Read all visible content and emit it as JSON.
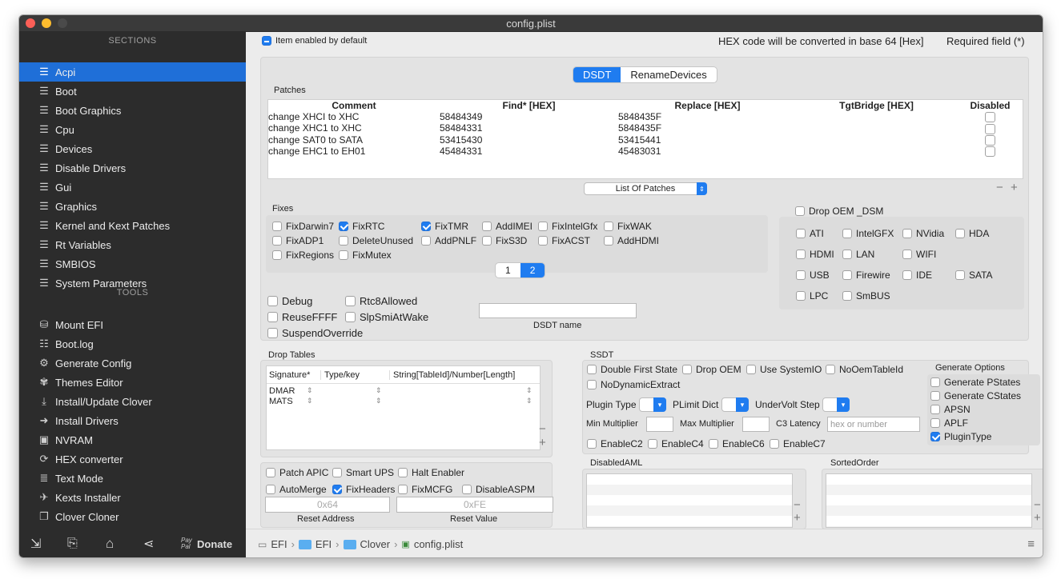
{
  "window": {
    "title": "config.plist"
  },
  "sidebar": {
    "sections_header": "SECTIONS",
    "sections": [
      {
        "label": "Acpi",
        "icon": "list-icon",
        "selected": true
      },
      {
        "label": "Boot",
        "icon": "list-icon"
      },
      {
        "label": "Boot Graphics",
        "icon": "list-icon"
      },
      {
        "label": "Cpu",
        "icon": "list-icon"
      },
      {
        "label": "Devices",
        "icon": "list-icon"
      },
      {
        "label": "Disable Drivers",
        "icon": "list-icon"
      },
      {
        "label": "Gui",
        "icon": "list-icon"
      },
      {
        "label": "Graphics",
        "icon": "list-icon"
      },
      {
        "label": "Kernel and Kext Patches",
        "icon": "list-icon"
      },
      {
        "label": "Rt Variables",
        "icon": "list-icon"
      },
      {
        "label": "SMBIOS",
        "icon": "list-icon"
      },
      {
        "label": "System Parameters",
        "icon": "list-icon"
      }
    ],
    "tools_header": "TOOLS",
    "tools": [
      {
        "label": "Mount EFI",
        "icon": "disk-icon"
      },
      {
        "label": "Boot.log",
        "icon": "log-search-icon"
      },
      {
        "label": "Generate Config",
        "icon": "gears-icon"
      },
      {
        "label": "Themes Editor",
        "icon": "palette-icon"
      },
      {
        "label": "Install/Update Clover",
        "icon": "download-icon"
      },
      {
        "label": "Install Drivers",
        "icon": "arrow-icon"
      },
      {
        "label": "NVRAM",
        "icon": "chip-icon"
      },
      {
        "label": "HEX converter",
        "icon": "refresh-icon"
      },
      {
        "label": "Text Mode",
        "icon": "text-lines-icon"
      },
      {
        "label": "Kexts Installer",
        "icon": "rocket-icon"
      },
      {
        "label": "Clover Cloner",
        "icon": "copy-icon"
      }
    ],
    "donate": {
      "paypal": "Pay Pal",
      "label": "Donate"
    }
  },
  "header": {
    "item_enabled": "Item enabled by default",
    "hex_note": "HEX code will be converted in base 64 [Hex]",
    "required": "Required field (*)"
  },
  "tabs": [
    "DSDT",
    "RenameDevices"
  ],
  "patches": {
    "title": "Patches",
    "columns": [
      "Comment",
      "Find* [HEX]",
      "Replace [HEX]",
      "TgtBridge [HEX]",
      "Disabled"
    ],
    "rows": [
      [
        "change XHCI to XHC",
        "58484349",
        "5848435F",
        ""
      ],
      [
        "change XHC1 to XHC",
        "58484331",
        "5848435F",
        ""
      ],
      [
        "change SAT0 to SATA",
        "53415430",
        "53415441",
        ""
      ],
      [
        "change EHC1 to EH01",
        "45484331",
        "45483031",
        ""
      ]
    ],
    "list_button": "List Of Patches"
  },
  "fixes": {
    "title": "Fixes",
    "items": [
      {
        "label": "FixDarwin7",
        "checked": false
      },
      {
        "label": "FixRTC",
        "checked": true
      },
      {
        "label": "FixTMR",
        "checked": true
      },
      {
        "label": "AddIMEI",
        "checked": false
      },
      {
        "label": "FixIntelGfx",
        "checked": false
      },
      {
        "label": "FixWAK",
        "checked": false
      },
      {
        "label": "FixADP1",
        "checked": false
      },
      {
        "label": "DeleteUnused",
        "checked": false
      },
      {
        "label": "AddPNLF",
        "checked": false
      },
      {
        "label": "FixS3D",
        "checked": false
      },
      {
        "label": "FixACST",
        "checked": false
      },
      {
        "label": "AddHDMI",
        "checked": false
      },
      {
        "label": "FixRegions",
        "checked": false
      },
      {
        "label": "FixMutex",
        "checked": false
      }
    ],
    "pages": [
      "1",
      "2"
    ]
  },
  "drop_oem_dsm": {
    "label": "Drop OEM _DSM",
    "items": [
      "ATI",
      "IntelGFX",
      "NVidia",
      "HDA",
      "HDMI",
      "LAN",
      "WIFI",
      "USB",
      "Firewire",
      "IDE",
      "SATA",
      "LPC",
      "SmBUS"
    ]
  },
  "misc": {
    "items": [
      "Debug",
      "Rtc8Allowed",
      "ReuseFFFF",
      "SlpSmiAtWake",
      "SuspendOverride"
    ],
    "dsdt_name_label": "DSDT name"
  },
  "drop_tables": {
    "title": "Drop Tables",
    "columns": [
      "Signature*",
      "Type/key",
      "String[TableId]/Number[Length]"
    ],
    "rows": [
      "DMAR",
      "MATS"
    ]
  },
  "ssdt": {
    "title": "SSDT",
    "checks": [
      "Double First State",
      "Drop OEM",
      "Use SystemIO",
      "NoOemTableId",
      "NoDynamicExtract"
    ],
    "plugin_type": "Plugin Type",
    "plimit_dict": "PLimit Dict",
    "undervolt_step": "UnderVolt Step",
    "min_multiplier": "Min Multiplier",
    "max_multiplier": "Max Multiplier",
    "c3_latency": "C3 Latency",
    "c3_placeholder": "hex or number",
    "cstates": [
      "EnableC2",
      "EnableC4",
      "EnableC6",
      "EnableC7"
    ],
    "generate_options": {
      "title": "Generate Options",
      "items": [
        {
          "label": "Generate PStates",
          "checked": false
        },
        {
          "label": "Generate CStates",
          "checked": false
        },
        {
          "label": "APSN",
          "checked": false
        },
        {
          "label": "APLF",
          "checked": false
        },
        {
          "label": "PluginType",
          "checked": true
        }
      ]
    }
  },
  "bottom_left": {
    "items": [
      {
        "label": "Patch APIC",
        "checked": false
      },
      {
        "label": "Smart UPS",
        "checked": false
      },
      {
        "label": "Halt Enabler",
        "checked": false
      },
      {
        "label": "AutoMerge",
        "checked": false
      },
      {
        "label": "FixHeaders",
        "checked": true
      },
      {
        "label": "FixMCFG",
        "checked": false
      },
      {
        "label": "DisableASPM",
        "checked": false
      }
    ],
    "reset_address_placeholder": "0x64",
    "reset_value_placeholder": "0xFE",
    "reset_address": "Reset Address",
    "reset_value": "Reset Value"
  },
  "disabled_aml": {
    "title": "DisabledAML"
  },
  "sorted_order": {
    "title": "SortedOrder"
  },
  "status": {
    "path": [
      "EFI",
      "EFI",
      "Clover",
      "config.plist"
    ]
  },
  "colors": {
    "accent": "#1f7cf0",
    "sidebar_bg": "#2c2c2c",
    "selected": "#1f6fd8"
  }
}
